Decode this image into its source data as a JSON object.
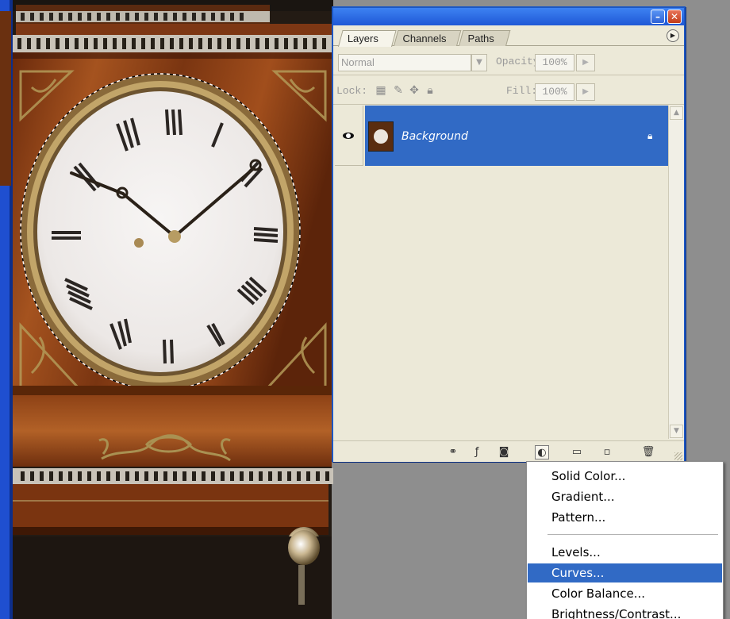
{
  "layers_palette": {
    "tabs": [
      {
        "label": "Layers",
        "active": true
      },
      {
        "label": "Channels",
        "active": false
      },
      {
        "label": "Paths",
        "active": false
      }
    ],
    "blend_mode": "Normal",
    "opacity_label": "Opacity:",
    "opacity_value": "100%",
    "lock_label": "Lock:",
    "fill_label": "Fill:",
    "fill_value": "100%",
    "layers": [
      {
        "name": "Background",
        "visible": true,
        "locked": true,
        "selected": true
      }
    ],
    "bottom_icons": [
      "link-icon",
      "layer-style-icon",
      "layer-mask-icon",
      "adjustment-layer-icon",
      "group-folder-icon",
      "new-layer-icon",
      "trash-icon"
    ]
  },
  "adjustment_menu": {
    "items": [
      {
        "label": "Solid Color...",
        "highlighted": false
      },
      {
        "label": "Gradient...",
        "highlighted": false
      },
      {
        "label": "Pattern...",
        "highlighted": false
      },
      {
        "label": "Levels...",
        "highlighted": false
      },
      {
        "label": "Curves...",
        "highlighted": true
      },
      {
        "label": "Color Balance...",
        "highlighted": false
      },
      {
        "label": "Brightness/Contrast...",
        "highlighted": false
      }
    ]
  },
  "colors": {
    "selection_blue": "#316ac5",
    "titlebar_blue": "#1f58d6",
    "palette_bg": "#ece9d8"
  }
}
